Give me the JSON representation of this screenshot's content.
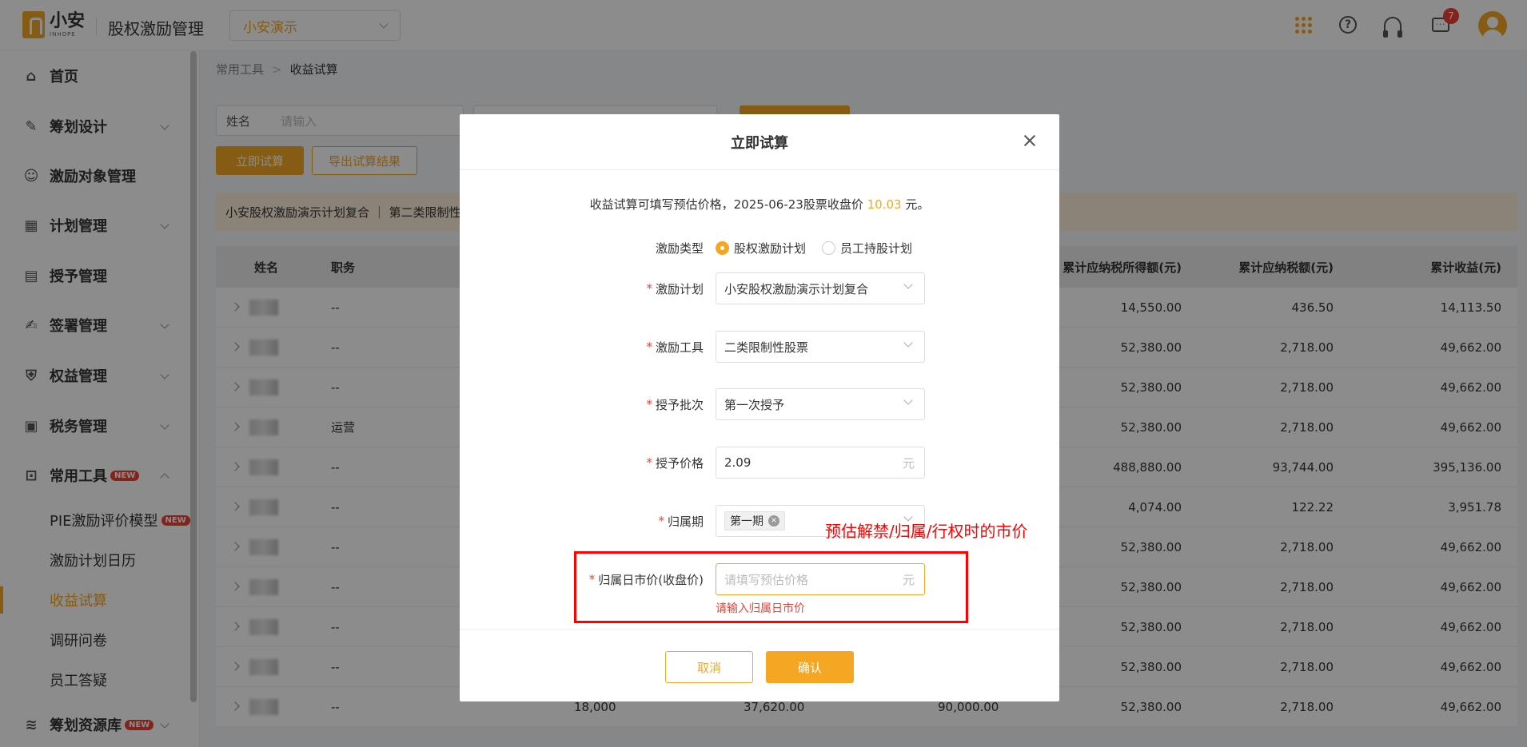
{
  "header": {
    "logo_cn": "小安",
    "logo_en": "INHOPE",
    "app_title": "股权激励管理",
    "company": "小安演示",
    "badge_count": "7"
  },
  "sidebar": {
    "items": [
      {
        "label": "首页",
        "icon": "home-icon"
      },
      {
        "label": "筹划设计",
        "icon": "edit-icon"
      },
      {
        "label": "激励对象管理",
        "icon": "users-icon"
      },
      {
        "label": "计划管理",
        "icon": "apps-icon"
      },
      {
        "label": "授予管理",
        "icon": "book-icon"
      },
      {
        "label": "签署管理",
        "icon": "sign-icon"
      },
      {
        "label": "权益管理",
        "icon": "shield-icon"
      },
      {
        "label": "税务管理",
        "icon": "tax-icon"
      },
      {
        "label": "常用工具",
        "icon": "toolbox-icon"
      }
    ],
    "sub_items": [
      "PIE激励评价模型",
      "激励计划日历",
      "收益试算",
      "调研问卷",
      "员工答疑"
    ],
    "resource": "筹划资源库",
    "new_label": "NEW"
  },
  "main": {
    "breadcrumb": [
      "常用工具",
      "收益试算"
    ],
    "filter_label": "姓名",
    "filter_placeholder": "请输入",
    "btn_calc": "立即试算",
    "btn_export": "导出试算结果",
    "notice": "小安股权激励演示计划复合 ｜ 第二类限制性",
    "columns": [
      "姓名",
      "职务",
      "累计应纳税所得额(元)",
      "累计应纳税额(元)",
      "累计收益(元)"
    ],
    "rows": [
      {
        "role": "--",
        "a": "14,550.00",
        "b": "436.50",
        "c": "14,113.50"
      },
      {
        "role": "--",
        "a": "52,380.00",
        "b": "2,718.00",
        "c": "49,662.00"
      },
      {
        "role": "--",
        "a": "52,380.00",
        "b": "2,718.00",
        "c": "49,662.00"
      },
      {
        "role": "运营",
        "a": "52,380.00",
        "b": "2,718.00",
        "c": "49,662.00"
      },
      {
        "role": "--",
        "a": "488,880.00",
        "b": "93,744.00",
        "c": "395,136.00"
      },
      {
        "role": "--",
        "a": "4,074.00",
        "b": "122.22",
        "c": "3,951.78"
      },
      {
        "role": "--",
        "a": "52,380.00",
        "b": "2,718.00",
        "c": "49,662.00"
      },
      {
        "role": "--",
        "a": "52,380.00",
        "b": "2,718.00",
        "c": "49,662.00"
      },
      {
        "role": "--",
        "a": "52,380.00",
        "b": "2,718.00",
        "c": "49,662.00"
      },
      {
        "role": "--",
        "a": "52,380.00",
        "b": "2,718.00",
        "c": "49,662.00"
      },
      {
        "role": "--",
        "a": "52,380.00",
        "b": "2,718.00",
        "c": "49,662.00"
      }
    ],
    "row11_extra": [
      "18,000",
      "37,620.00",
      "90,000.00"
    ]
  },
  "modal": {
    "title": "立即试算",
    "info_prefix": "收益试算可填写预估价格，2025-06-23股票收盘价",
    "info_price": "10.03",
    "info_suffix": "元。",
    "type_label": "激励类型",
    "type_options": [
      "股权激励计划",
      "员工持股计划"
    ],
    "plan_label": "激励计划",
    "plan_value": "小安股权激励演示计划复合",
    "tool_label": "激励工具",
    "tool_value": "二类限制性股票",
    "batch_label": "授予批次",
    "batch_value": "第一次授予",
    "price_label": "授予价格",
    "price_value": "2.09",
    "unit": "元",
    "period_label": "归属期",
    "period_tag": "第一期",
    "market_label": "归属日市价(收盘价)",
    "market_placeholder": "请填写预估价格",
    "error_msg": "请输入归属日市价",
    "cancel": "取消",
    "confirm": "确认"
  },
  "annotation": {
    "text": "预估解禁/归属/行权时的市价",
    "color": "#ff0000"
  },
  "colors": {
    "accent": "#f5a623",
    "error": "#f04134"
  }
}
